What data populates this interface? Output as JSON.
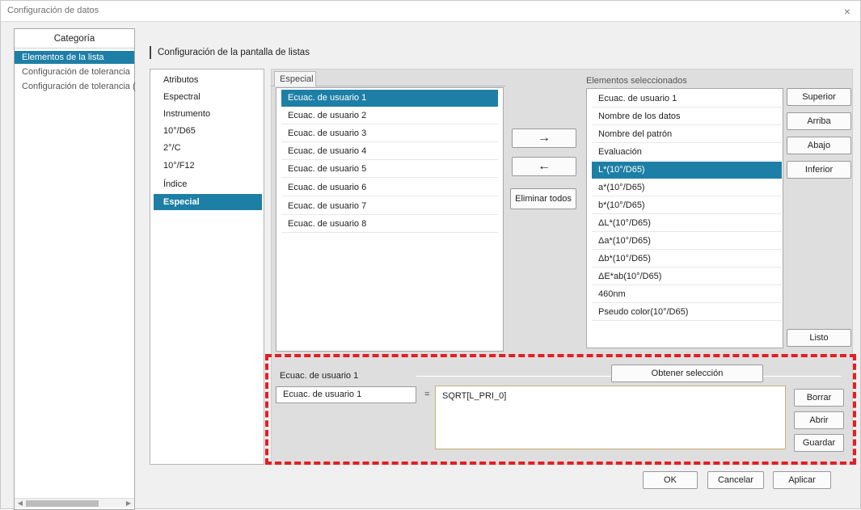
{
  "window": {
    "title": "Configuración de datos",
    "close_glyph": "×"
  },
  "nav": {
    "header": "Categoría",
    "items": [
      {
        "label": "Elementos de la lista",
        "selected": true
      },
      {
        "label": "Configuración de tolerancia",
        "selected": false
      },
      {
        "label": "Configuración de tolerancia (",
        "selected": false
      }
    ],
    "scroll_left": "◀",
    "scroll_right": "▶"
  },
  "section": {
    "title": "Configuración de la pantalla de listas"
  },
  "categories": [
    {
      "label": "Atributos"
    },
    {
      "label": "Espectral"
    },
    {
      "label": "Instrumento"
    },
    {
      "label": "10°/D65"
    },
    {
      "label": "2°/C"
    },
    {
      "label": "10°/F12"
    },
    {
      "label": "Índice"
    },
    {
      "label": "Especial",
      "selected": true
    }
  ],
  "available": {
    "tab": "Especial",
    "items": [
      "Ecuac. de usuario 1",
      "Ecuac. de usuario 2",
      "Ecuac. de usuario 3",
      "Ecuac. de usuario 4",
      "Ecuac. de usuario 5",
      "Ecuac. de usuario 6",
      "Ecuac. de usuario 7",
      "Ecuac. de usuario 8"
    ]
  },
  "transfer": {
    "add": "→",
    "remove": "←",
    "remove_all": "Eliminar todos"
  },
  "selected": {
    "header": "Elementos seleccionados",
    "items": [
      "Ecuac. de usuario 1",
      "Nombre de los datos",
      "Nombre del patrón",
      "Evaluación",
      "L*(10°/D65)",
      "a*(10°/D65)",
      "b*(10°/D65)",
      "ΔL*(10°/D65)",
      "Δa*(10°/D65)",
      "Δb*(10°/D65)",
      "ΔE*ab(10°/D65)",
      "460nm",
      "Pseudo color(10°/D65)"
    ]
  },
  "order": {
    "top": "Superior",
    "up": "Arriba",
    "down": "Abajo",
    "bottom": "Inferior",
    "done": "Listo"
  },
  "editor": {
    "label": "Ecuac. de usuario 1",
    "get_selection": "Obtener selección",
    "name_value": "Ecuac. de usuario 1",
    "equals": "=",
    "formula": "SQRT[L_PRI_0]",
    "clear": "Borrar",
    "open": "Abrir",
    "save": "Guardar"
  },
  "footer": {
    "ok": "OK",
    "cancel": "Cancelar",
    "apply": "Aplicar"
  },
  "colors": {
    "selection": "#1e7fa6",
    "highlight_border": "#e31e24"
  }
}
